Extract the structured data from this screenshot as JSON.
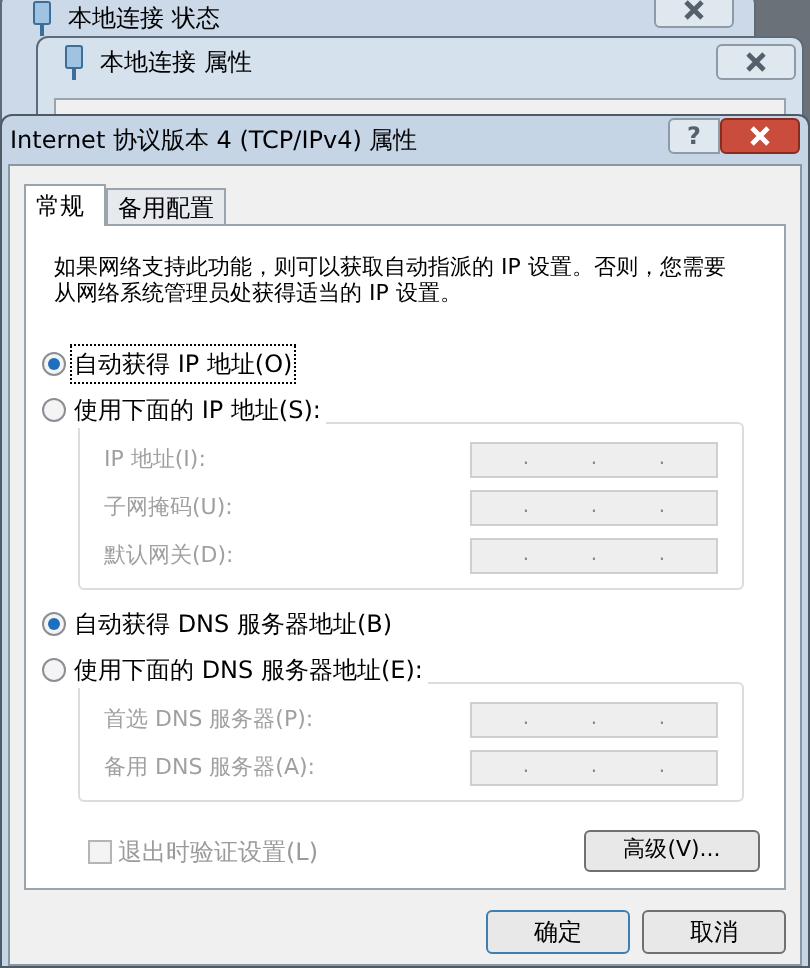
{
  "background_windows": [
    {
      "title": "本地连接 状态"
    },
    {
      "title": "本地连接 属性"
    }
  ],
  "window": {
    "title": "Internet 协议版本 4 (TCP/IPv4) 属性",
    "help": "?"
  },
  "tabs": [
    {
      "label": "常规",
      "selected": true
    },
    {
      "label": "备用配置",
      "selected": false
    }
  ],
  "description": "如果网络支持此功能，则可以获取自动指派的 IP 设置。否则，您需要从网络系统管理员处获得适当的 IP 设置。",
  "ip_section": {
    "options": [
      {
        "label": "自动获得 IP 地址(O)",
        "selected": true
      },
      {
        "label": "使用下面的 IP 地址(S):",
        "selected": false
      }
    ],
    "fields": [
      {
        "label": "IP 地址(I):",
        "disabled": true,
        "separators": [
          ".",
          ".",
          "."
        ]
      },
      {
        "label": "子网掩码(U):",
        "disabled": true,
        "separators": [
          ".",
          ".",
          "."
        ]
      },
      {
        "label": "默认网关(D):",
        "disabled": true,
        "separators": [
          ".",
          ".",
          "."
        ]
      }
    ]
  },
  "dns_section": {
    "options": [
      {
        "label": "自动获得 DNS 服务器地址(B)",
        "selected": true
      },
      {
        "label": "使用下面的 DNS 服务器地址(E):",
        "selected": false
      }
    ],
    "fields": [
      {
        "label": "首选 DNS 服务器(P):",
        "disabled": true,
        "separators": [
          ".",
          ".",
          "."
        ]
      },
      {
        "label": "备用 DNS 服务器(A):",
        "disabled": true,
        "separators": [
          ".",
          ".",
          "."
        ]
      }
    ]
  },
  "validate": {
    "label": "退出时验证设置(L)",
    "checked": false,
    "disabled": true
  },
  "advanced_button": "高级(V)...",
  "buttons": [
    "确定",
    "取消"
  ]
}
